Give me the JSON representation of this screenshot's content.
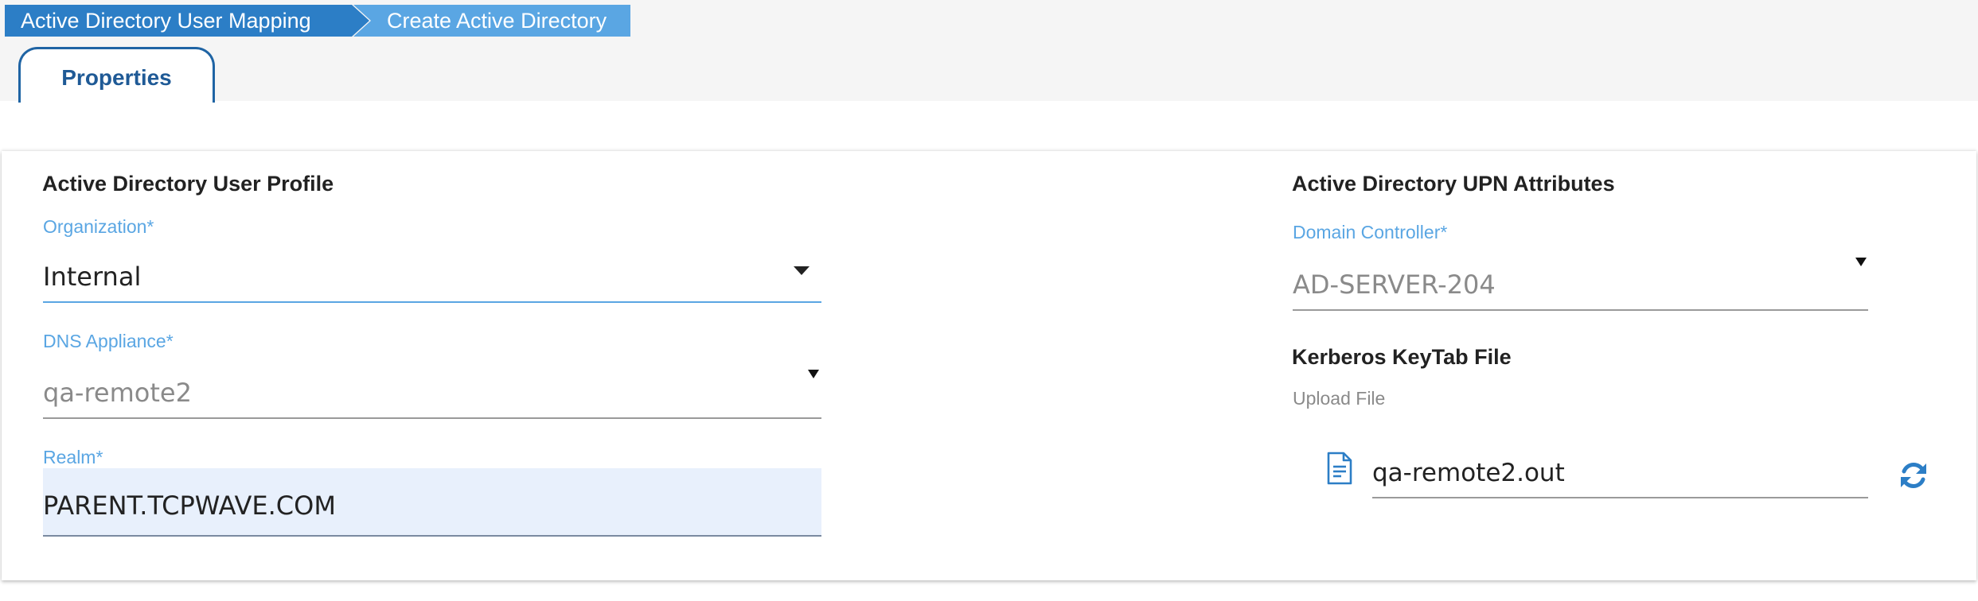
{
  "breadcrumb": {
    "items": [
      {
        "label": "Active Directory User Mapping"
      },
      {
        "label": "Create Active Directory"
      }
    ]
  },
  "tabs": [
    {
      "label": "Properties",
      "active": true
    }
  ],
  "left_section": {
    "title": "Active Directory User Profile",
    "organization": {
      "label": "Organization*",
      "value": "Internal"
    },
    "dns_appliance": {
      "label": "DNS Appliance*",
      "value": "qa-remote2"
    },
    "realm": {
      "label": "Realm*",
      "value": "PARENT.TCPWAVE.COM"
    }
  },
  "right_section": {
    "title": "Active Directory UPN Attributes",
    "domain_controller": {
      "label": "Domain Controller*",
      "value": "AD-SERVER-204"
    },
    "keytab": {
      "title": "Kerberos KeyTab File",
      "upload_label": "Upload File",
      "file_name": "qa-remote2.out"
    }
  },
  "icons": {
    "file": "document-icon",
    "refresh": "refresh-icon",
    "dropdown": "caret-down-icon"
  },
  "colors": {
    "breadcrumb_primary": "#2c7ec6",
    "breadcrumb_secondary": "#5aa6e3",
    "tab_border": "#1f64a4",
    "label_accent": "#5aa6e3",
    "input_fill": "#e8f0fc",
    "icon_blue": "#2c7ec6"
  }
}
